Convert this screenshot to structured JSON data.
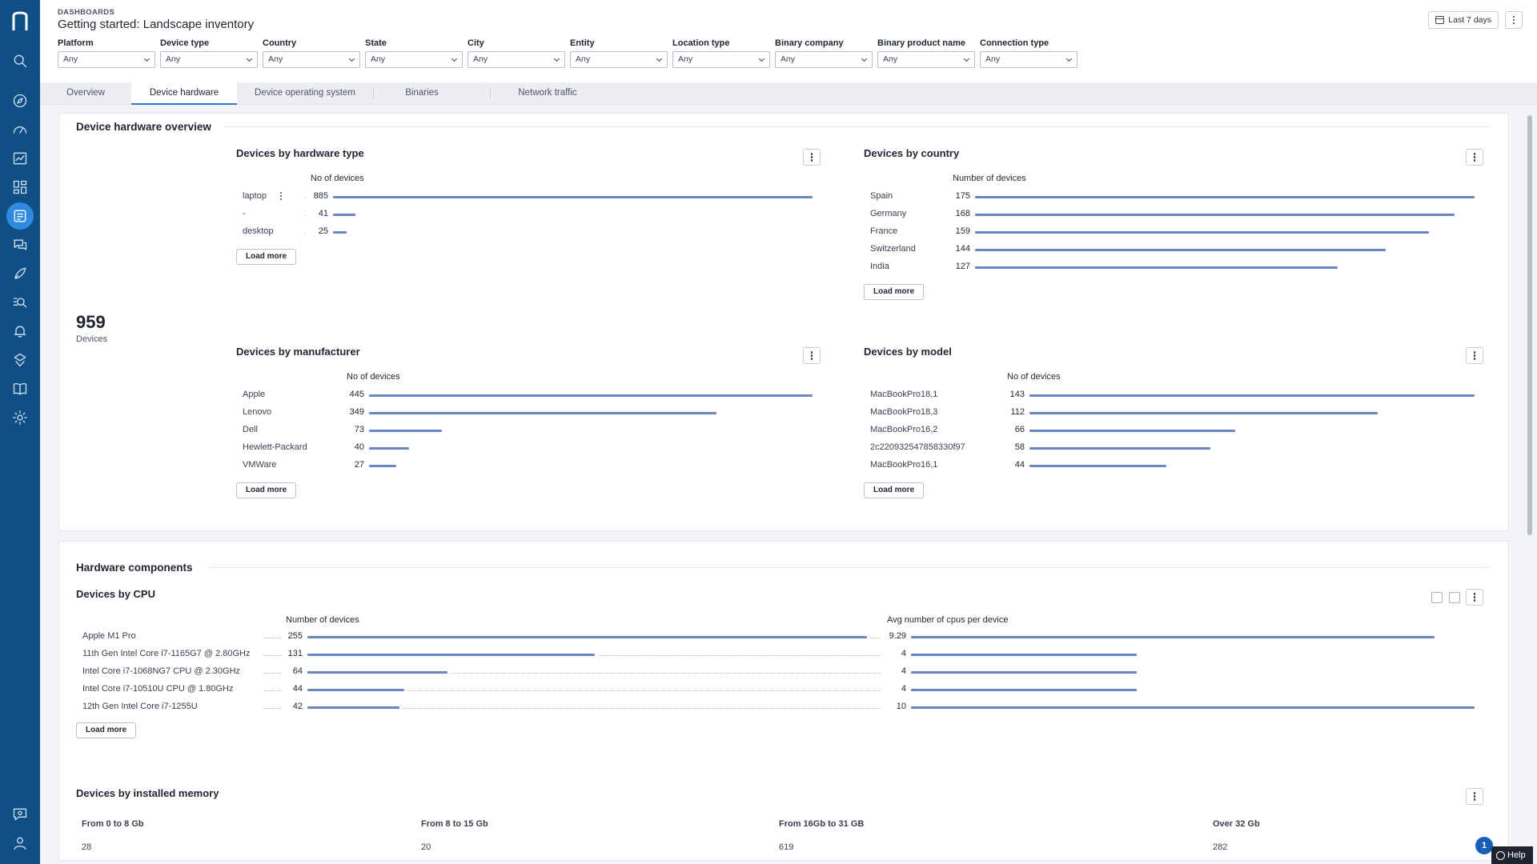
{
  "sidebar": {
    "logo": "nexthink-logo",
    "items": [
      {
        "icon": "search-icon"
      },
      {
        "icon": "compass-icon"
      },
      {
        "icon": "gauge-icon"
      },
      {
        "icon": "chart-icon"
      },
      {
        "icon": "dashboard-grid-icon"
      },
      {
        "icon": "dashboards-icon",
        "active": true
      },
      {
        "icon": "chat-icon"
      },
      {
        "icon": "rocket-icon"
      },
      {
        "icon": "investigation-icon"
      },
      {
        "icon": "bell-icon"
      },
      {
        "icon": "remote-action-icon"
      },
      {
        "icon": "library-icon"
      },
      {
        "icon": "gear-icon"
      },
      {
        "icon": "feedback-icon"
      },
      {
        "icon": "user-icon"
      }
    ]
  },
  "header": {
    "breadcrumb": "DASHBOARDS",
    "title": "Getting started: Landscape inventory",
    "time_range": "Last 7 days"
  },
  "filters": [
    {
      "label": "Platform",
      "value": "Any"
    },
    {
      "label": "Device type",
      "value": "Any"
    },
    {
      "label": "Country",
      "value": "Any"
    },
    {
      "label": "State",
      "value": "Any"
    },
    {
      "label": "City",
      "value": "Any"
    },
    {
      "label": "Entity",
      "value": "Any"
    },
    {
      "label": "Location type",
      "value": "Any"
    },
    {
      "label": "Binary company",
      "value": "Any"
    },
    {
      "label": "Binary product name",
      "value": "Any"
    },
    {
      "label": "Connection type",
      "value": "Any"
    }
  ],
  "tabs": [
    {
      "label": "Overview"
    },
    {
      "label": "Device hardware",
      "active": true
    },
    {
      "label": "Device operating system"
    },
    {
      "label": "Binaries"
    },
    {
      "label": "Network traffic"
    }
  ],
  "overview": {
    "section_title": "Device hardware overview",
    "kpi_value": "959",
    "kpi_label": "Devices"
  },
  "load_more": "Load more",
  "cards": {
    "hardware_type": {
      "title": "Devices by hardware type",
      "column": "No of devices",
      "rows": [
        {
          "label": "laptop",
          "value": 885
        },
        {
          "label": "-",
          "value": 41
        },
        {
          "label": "desktop",
          "value": 25
        }
      ]
    },
    "country": {
      "title": "Devices by country",
      "column": "Number of devices",
      "rows": [
        {
          "label": "Spain",
          "value": 175
        },
        {
          "label": "Germany",
          "value": 168
        },
        {
          "label": "France",
          "value": 159
        },
        {
          "label": "Switzerland",
          "value": 144
        },
        {
          "label": "India",
          "value": 127
        }
      ]
    },
    "manufacturer": {
      "title": "Devices by manufacturer",
      "column": "No of devices",
      "rows": [
        {
          "label": "Apple",
          "value": 445
        },
        {
          "label": "Lenovo",
          "value": 349
        },
        {
          "label": "Dell",
          "value": 73
        },
        {
          "label": "Hewlett-Packard",
          "value": 40
        },
        {
          "label": "VMWare",
          "value": 27
        }
      ]
    },
    "model": {
      "title": "Devices by model",
      "column": "No of devices",
      "rows": [
        {
          "label": "MacBookPro18,1",
          "value": 143
        },
        {
          "label": "MacBookPro18,3",
          "value": 112
        },
        {
          "label": "MacBookPro16,2",
          "value": 66
        },
        {
          "label": "2c220932547858330f97",
          "value": 58
        },
        {
          "label": "MacBookPro16,1",
          "value": 44
        }
      ]
    }
  },
  "components": {
    "section_title": "Hardware components",
    "cpu": {
      "title": "Devices by CPU",
      "column_count": "Number of devices",
      "column_avg": "Avg number of cpus per device",
      "rows": [
        {
          "label": "Apple M1 Pro",
          "count": 255,
          "avg": "9.29",
          "avg_num": 9.29
        },
        {
          "label": "11th Gen Intel Core i7-1165G7 @ 2.80GHz",
          "count": 131,
          "avg": "4",
          "avg_num": 4
        },
        {
          "label": "Intel Core i7-1068NG7 CPU @ 2.30GHz",
          "count": 64,
          "avg": "4",
          "avg_num": 4
        },
        {
          "label": "Intel Core i7-10510U CPU @ 1.80GHz",
          "count": 44,
          "avg": "4",
          "avg_num": 4
        },
        {
          "label": "12th Gen Intel Core i7-1255U",
          "count": 42,
          "avg": "10",
          "avg_num": 10
        }
      ]
    },
    "memory": {
      "title": "Devices by installed memory",
      "columns": [
        {
          "label": "From 0 to 8 Gb",
          "value": "28"
        },
        {
          "label": "From 8 to 15 Gb",
          "value": "20"
        },
        {
          "label": "From 16Gb to 31 GB",
          "value": "619"
        },
        {
          "label": "Over 32 Gb",
          "value": "282"
        }
      ]
    }
  },
  "help": {
    "label": "Help",
    "notifications": "1"
  },
  "colors": {
    "sidebar": "#0f4f86",
    "bar": "#6a86c2",
    "active_tab": "#2f7ad6"
  }
}
